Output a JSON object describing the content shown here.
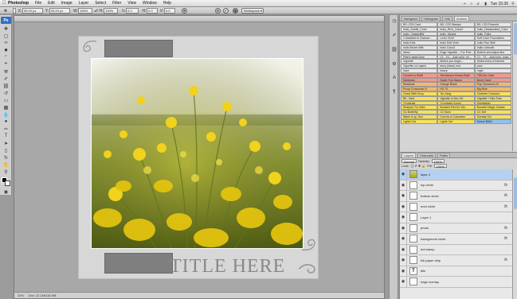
{
  "menubar": {
    "apple": "",
    "app_name": "Photoshop",
    "items": [
      "File",
      "Edit",
      "Image",
      "Layer",
      "Select",
      "Filter",
      "View",
      "Window",
      "Help"
    ],
    "clock": "Tue 15:36"
  },
  "appbar": {
    "w_value": "2764.5 px",
    "h_value": "2764.5 px",
    "x_value": "95.00 px",
    "y_value": "95.00 px",
    "angle": "0.0",
    "workspace": "Workspace ▾"
  },
  "document": {
    "tab_title": "",
    "title_text": "TITLE HERE",
    "status_zoom": "11%",
    "status_doc": "Doc: 22.1M/116.0M"
  },
  "panels": {
    "tabs": [
      "Navigator",
      "Histogram",
      "Info",
      "Actions"
    ],
    "active_tab": "Actions",
    "layers_tabs": [
      "Layers",
      "Channels",
      "Paths"
    ],
    "blend_mode": "Normal",
    "opacity_label": "Opacity:",
    "opacity_value": "100%",
    "lock_label": "Lock:",
    "fill_label": "Fill:",
    "fill_value": "100%"
  },
  "actions": [
    {
      "label": "BS: CS3 Card",
      "color": "#e8e8e8"
    },
    {
      "label": "BS: CS3 Stamps",
      "color": "#e8e8e8"
    },
    {
      "label": "BS: CS3 Polaroid",
      "color": "#e8e8e8"
    },
    {
      "label": "Indio_Subtle_Color",
      "color": "#e8e8e8"
    },
    {
      "label": "Indio_Rich_Color3",
      "color": "#e8e8e8"
    },
    {
      "label": "Indio_Desaturated_Color",
      "color": "#e8e8e8"
    },
    {
      "label": "Indio_ClassicBW",
      "color": "#e8e8e8"
    },
    {
      "label": "Indio_Mocha",
      "color": "#e8e8e8"
    },
    {
      "label": "Indio_Folky",
      "color": "#e8e8e8"
    },
    {
      "label": "\\\\ Addicted to Nuance...",
      "color": "#e8e8e8"
    },
    {
      "label": "Lomo Vivid",
      "color": "#e8e8e8"
    },
    {
      "label": "Soft Color Foundation",
      "color": "#e8e8e8"
    },
    {
      "label": "Indio Kids",
      "color": "#e8e8e8"
    },
    {
      "label": "Indio Soft Vivid",
      "color": "#e8e8e8"
    },
    {
      "label": "Indio Fine Skill",
      "color": "#e8e8e8"
    },
    {
      "label": "Indio Brown Milk",
      "color": "#e8e8e8"
    },
    {
      "label": "Indio Color3",
      "color": "#e8e8e8"
    },
    {
      "label": "Indio Unbooth",
      "color": "#e8e8e8"
    },
    {
      "label": "dress",
      "color": "#e8e8e8"
    },
    {
      "label": "Edge Vignette -- For Port...",
      "color": "#e8e8e8"
    },
    {
      "label": "Bottom and adjust line",
      "color": "#e8e8e8"
    },
    {
      "label": "Pete's faded blue",
      "color": "#e8e8e8"
    },
    {
      "label": "C1 - V1 -- Add color, ch...",
      "color": "#e8e8e8"
    },
    {
      "label": "C1 - T2 -- Add color, chan...",
      "color": "#e8e8e8"
    },
    {
      "label": "Vignette",
      "color": "#e8e8e8"
    },
    {
      "label": "Before you begin...",
      "color": "#e8e8e8"
    },
    {
      "label": "Select Area of Interest",
      "color": "#e8e8e8"
    },
    {
      "label": "Vignette on Layers",
      "color": "#e8e8e8"
    },
    {
      "label": "berry (base) end",
      "color": "#e8e8e8"
    },
    {
      "label": "pout",
      "color": "#e8e8e8"
    },
    {
      "label": "haze",
      "color": "#e8e8e8"
    },
    {
      "label": "heavy",
      "color": "#e8e8e8"
    },
    {
      "label": "roger",
      "color": "#e8e8e8"
    },
    {
      "label": "Convert to B&W",
      "color": "#f29a8e"
    },
    {
      "label": "Technicolor Dream Bold",
      "color": "#f29a8e"
    },
    {
      "label": "TDB No Color",
      "color": "#f29a8e"
    },
    {
      "label": "Darkness",
      "color": "#f29a8e"
    },
    {
      "label": "Super Fun Happy",
      "color": "#f29a8e"
    },
    {
      "label": "Burnt Cape",
      "color": "#f29a8e"
    },
    {
      "label": "Shadows",
      "color": "#f5b870"
    },
    {
      "label": "Orange Black",
      "color": "#f5b870"
    },
    {
      "label": "Pop Cinnamon IV",
      "color": "#f5b870"
    },
    {
      "label": "Proxy Crossroad IV",
      "color": "#f5b870"
    },
    {
      "label": "HS 70",
      "color": "#f5b870"
    },
    {
      "label": "Big Blue",
      "color": "#f5b870"
    },
    {
      "label": "Chest With Envy",
      "color": "#f7e15a"
    },
    {
      "label": "Yin-Yang",
      "color": "#f7e15a"
    },
    {
      "label": "Carefree Cocoons",
      "color": "#f7e15a"
    },
    {
      "label": "BK, Vivid",
      "color": "#f7e15a"
    },
    {
      "label": "Vignette & Blur HS",
      "color": "#f7e15a"
    },
    {
      "label": "Vignette + Blur Fest",
      "color": "#f7e15a"
    },
    {
      "label": "+Contrast",
      "color": "#f7e15a"
    },
    {
      "label": "+Contrast (Long)",
      "color": "#f7e15a"
    },
    {
      "label": "Quicksilver",
      "color": "#f7e15a"
    },
    {
      "label": "Sharpen For Web",
      "color": "#f7e15a"
    },
    {
      "label": "Boosted Red for We...",
      "color": "#f7e15a"
    },
    {
      "label": "Boosted Magic Classic",
      "color": "#f7e15a"
    },
    {
      "label": "Go Butterfly",
      "color": "#f7e15a"
    },
    {
      "label": "CC Burn",
      "color": "#f7e15a"
    },
    {
      "label": "CC Def",
      "color": "#f7e15a"
    },
    {
      "label": "Warm it up, Sun",
      "color": "#f7e15a"
    },
    {
      "label": "Cool as a Cucumber",
      "color": "#f7e15a"
    },
    {
      "label": "Sunday Sol",
      "color": "#f7e15a"
    },
    {
      "label": "Lights Out",
      "color": "#f7e15a"
    },
    {
      "label": "Lights Out",
      "color": "#f7e15a"
    },
    {
      "label": "Dense B&W",
      "color": "#8ec3f0"
    }
  ],
  "layers": [
    {
      "name": "layer 4",
      "fx": false,
      "thumb": "photo",
      "selected": true
    },
    {
      "name": "top circle",
      "fx": true,
      "thumb": "plain",
      "selected": false
    },
    {
      "name": "bottom circle",
      "fx": true,
      "thumb": "plain",
      "selected": false
    },
    {
      "name": "mod circle",
      "fx": true,
      "thumb": "plain",
      "selected": false
    },
    {
      "name": "Layer 1",
      "fx": false,
      "thumb": "plain",
      "selected": false
    },
    {
      "name": "photo",
      "fx": true,
      "thumb": "plain",
      "selected": false
    },
    {
      "name": "background circle",
      "fx": true,
      "thumb": "plain",
      "selected": false
    },
    {
      "name": "dot stamp",
      "fx": false,
      "thumb": "plain",
      "selected": false
    },
    {
      "name": "full paper strip",
      "fx": true,
      "thumb": "plain",
      "selected": false
    },
    {
      "name": "title",
      "fx": false,
      "thumb": "text",
      "selected": false
    },
    {
      "name": "edge overlay",
      "fx": false,
      "thumb": "plain",
      "selected": false
    }
  ]
}
